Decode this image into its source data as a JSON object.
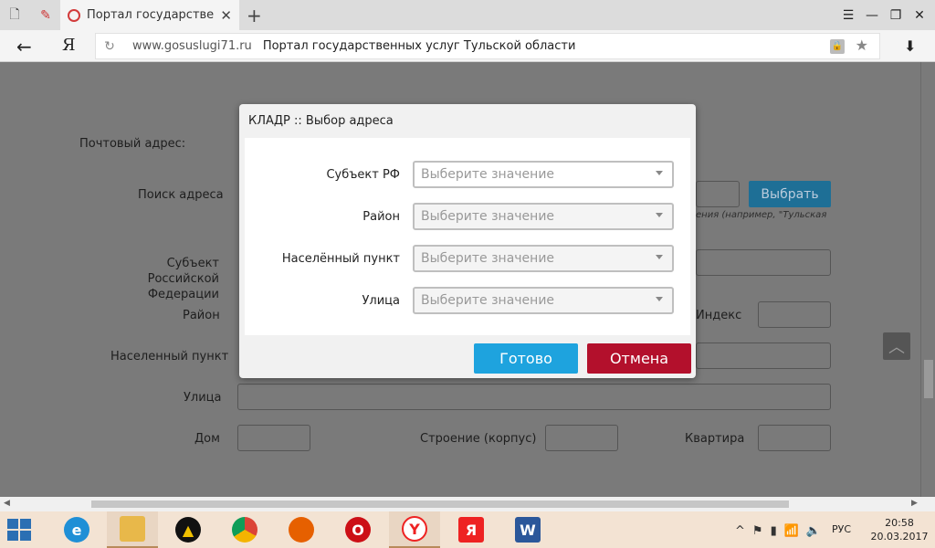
{
  "browser": {
    "tab_title": "Портал государственных",
    "tab_close": "✕",
    "new_tab": "+",
    "yandex_letter": "Я",
    "url_domain": "www.gosuslugi71.ru",
    "page_title": "Портал государственных услуг Тульской области"
  },
  "page": {
    "postal_address_label": "Почтовый адрес:",
    "search_label": "Поиск адреса",
    "pick_button": "Выбрать",
    "search_hint": "ения (например, \"Тульская",
    "subject_label_1": "Субъект Российской",
    "subject_label_2": "Федерации",
    "district_label": "Район",
    "index_label": "Индекс",
    "locality_label": "Населенный пункт",
    "street_label": "Улица",
    "house_label": "Дом",
    "building_label": "Строение (корпус)",
    "apartment_label": "Квартира"
  },
  "modal": {
    "title": "КЛАДР :: Выбор адреса",
    "rows": [
      {
        "label": "Субъект РФ",
        "placeholder": "Выберите значение"
      },
      {
        "label": "Район",
        "placeholder": "Выберите значение"
      },
      {
        "label": "Населённый пункт",
        "placeholder": "Выберите значение"
      },
      {
        "label": "Улица",
        "placeholder": "Выберите значение"
      }
    ],
    "ok_button": "Готово",
    "cancel_button": "Отмена",
    "ok_color": "#1ea3de",
    "cancel_color": "#b3102c"
  },
  "taskbar": {
    "apps": [
      "internet-explorer",
      "file-explorer",
      "archicad",
      "chrome",
      "firefox",
      "opera",
      "yandex-browser",
      "yandex",
      "word"
    ],
    "lang": "РУС",
    "time": "20:58",
    "date": "20.03.2017"
  }
}
